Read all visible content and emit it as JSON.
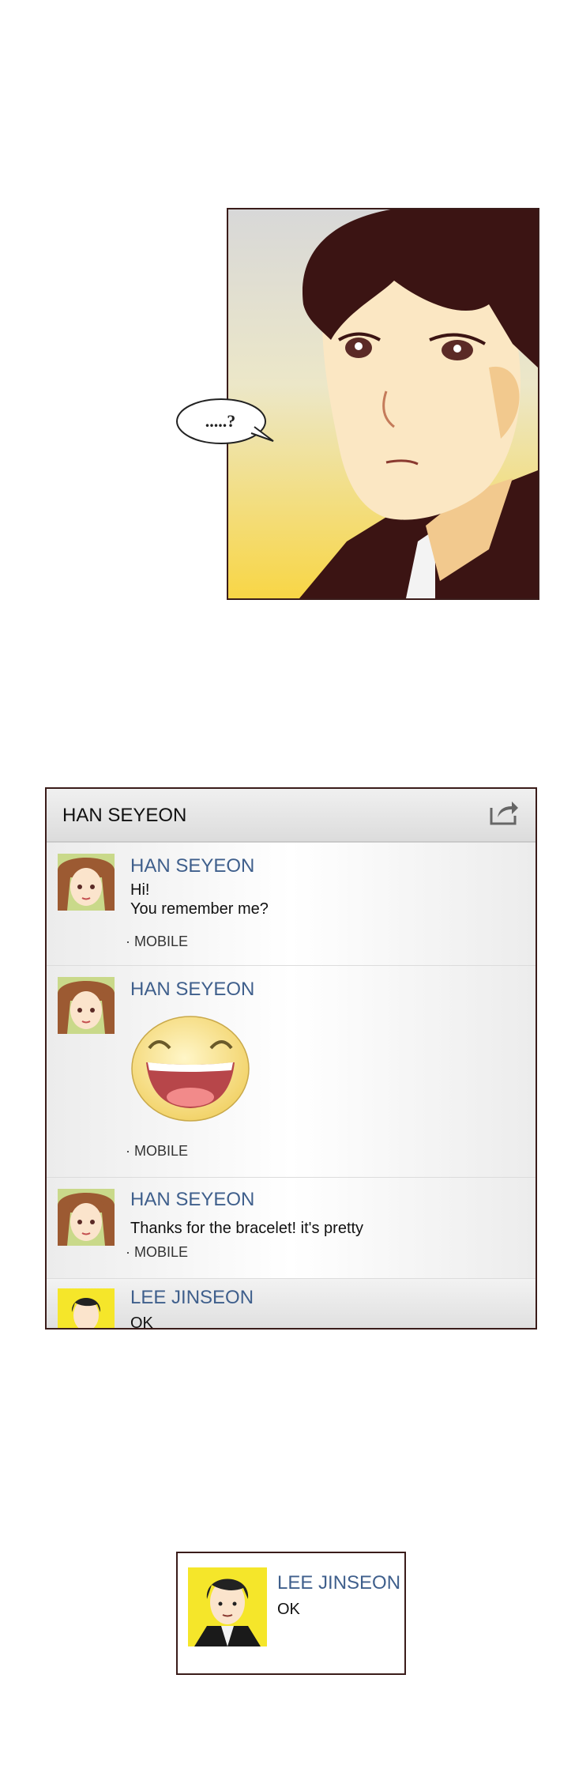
{
  "panel": {
    "speech": ".....?"
  },
  "messenger": {
    "title": "HAN SEYEON",
    "messages": [
      {
        "sender": "HAN SEYEON",
        "lines": [
          "Hi!",
          "You remember me?"
        ],
        "source": "· MOBILE"
      },
      {
        "sender": "HAN SEYEON",
        "sticker": "laughing-face-sticker",
        "source": "· MOBILE"
      },
      {
        "sender": "HAN SEYEON",
        "lines": [
          "Thanks for the bracelet! it's pretty"
        ],
        "source": "· MOBILE"
      },
      {
        "sender": "LEE JINSEON",
        "lines": [
          "OK"
        ]
      }
    ]
  },
  "notification": {
    "sender": "LEE JINSEON",
    "text": "OK"
  },
  "colors": {
    "name": "#3f5f8c",
    "border": "#3a1c1a",
    "panel_bg_top": "#d9d9d9",
    "panel_bg_bottom": "#f9d64a"
  }
}
